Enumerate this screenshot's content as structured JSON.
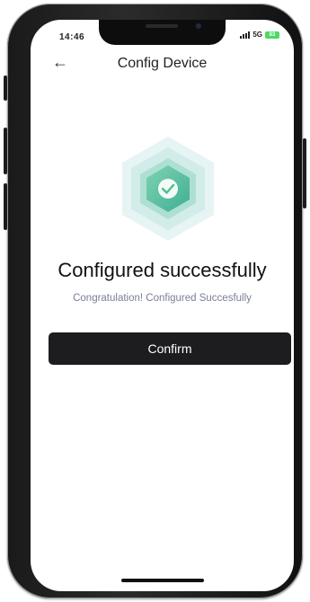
{
  "status_bar": {
    "time": "14:46",
    "network": "5G",
    "battery": "83"
  },
  "header": {
    "back_icon": "arrow-left-icon",
    "title": "Config Device"
  },
  "success": {
    "icon": "check-circle-icon",
    "headline": "Configured successfully",
    "message": "Congratulation! Configured Succesfully"
  },
  "actions": {
    "confirm_label": "Confirm"
  },
  "colors": {
    "accent_green": "#4cbf8a",
    "button_dark": "#1d1d1f",
    "subtext": "#7a7f96"
  }
}
